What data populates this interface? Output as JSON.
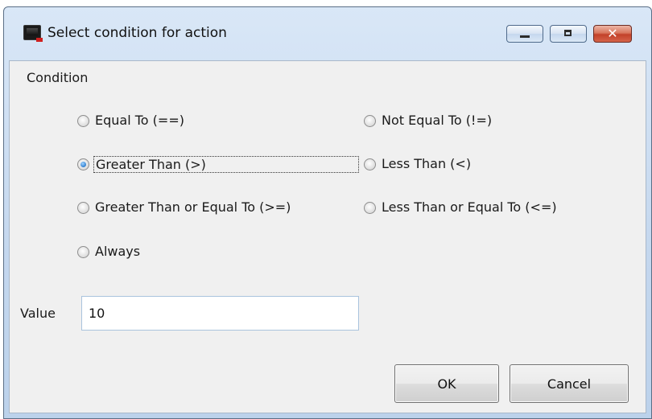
{
  "window": {
    "title": "Select condition for action",
    "icon": "terminal-app-icon"
  },
  "title_controls": {
    "minimize_icon": "minimize-icon",
    "maximize_icon": "maximize-icon",
    "close_glyph": "✕"
  },
  "condition": {
    "heading": "Condition",
    "selected": "Greater Than (>)",
    "options": [
      {
        "label": "Equal To (==)",
        "checked": false
      },
      {
        "label": "Not Equal To (!=)",
        "checked": false
      },
      {
        "label": "Greater Than (>)",
        "checked": true
      },
      {
        "label": "Less Than (<)",
        "checked": false
      },
      {
        "label": "Greater Than or Equal To (>=)",
        "checked": false
      },
      {
        "label": "Less Than or Equal To (<=)",
        "checked": false
      },
      {
        "label": "Always",
        "checked": false
      }
    ]
  },
  "value": {
    "label": "Value",
    "current": "10"
  },
  "buttons": {
    "ok": "OK",
    "cancel": "Cancel"
  },
  "colors": {
    "radio_selected": "#2f7fd0",
    "close_button": "#c2412a",
    "titlebar": "#c4d7ee"
  }
}
